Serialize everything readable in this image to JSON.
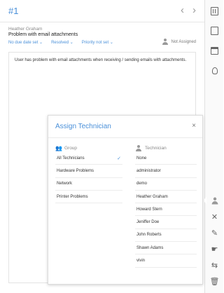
{
  "ticket": {
    "id": "#1",
    "requester": "Heather Graham",
    "subject": "Problem with email attachments",
    "due_date": "No due date set",
    "status": "Resolved",
    "priority": "Priority not set",
    "assignee": "Not Assigned",
    "description": "User has problem with email attachments when receiving / sending emails with attachments."
  },
  "nav": {
    "prev_glyph": "‹",
    "next_glyph": "›"
  },
  "modal": {
    "title": "Assign Technician",
    "close_glyph": "×",
    "group_header": "Group",
    "technician_header": "Technician",
    "groups": [
      {
        "label": "All Technicians",
        "selected": true
      },
      {
        "label": "Hardware Problems",
        "selected": false
      },
      {
        "label": "Network",
        "selected": false
      },
      {
        "label": "Printer Problems",
        "selected": false
      }
    ],
    "technicians": [
      "None",
      "administrator",
      "demo",
      "Heather Graham",
      "Howard Stern",
      "Jeniffer Doe",
      "John Roberts",
      "Shawn Adams",
      "vivin"
    ]
  },
  "toolbar": {
    "icons": [
      "properties-icon",
      "conversation-icon",
      "calendar-icon",
      "bulb-icon",
      "assign-icon",
      "close-ticket-icon",
      "edit-icon",
      "pickup-icon",
      "move-icon",
      "delete-icon"
    ]
  },
  "colors": {
    "accent": "#4a90d9",
    "text": "#333333",
    "muted": "#888888"
  }
}
